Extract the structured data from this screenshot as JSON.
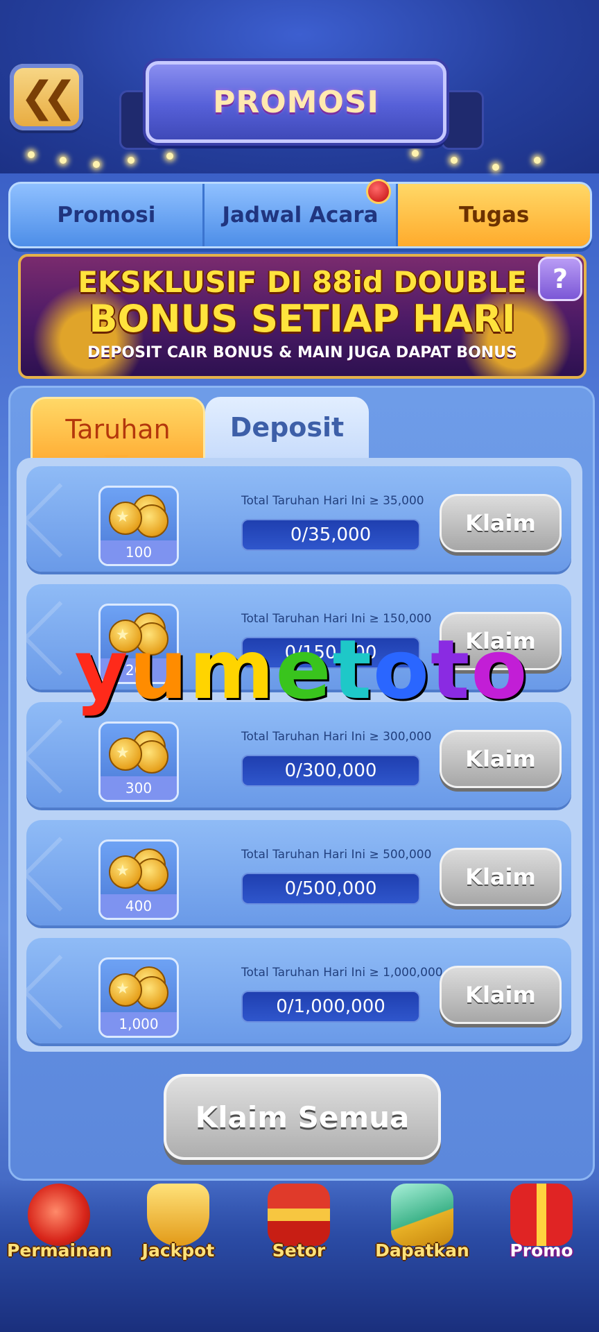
{
  "header": {
    "title": "PROMOSI",
    "back_icon": "double-chevron-left-icon"
  },
  "top_tabs": [
    {
      "label": "Promosi",
      "active": false
    },
    {
      "label": "Jadwal Acara",
      "active": false,
      "has_notification": true
    },
    {
      "label": "Tugas",
      "active": true
    }
  ],
  "banner": {
    "line1": "EKSKLUSIF DI 88id DOUBLE",
    "line2": "BONUS SETIAP HARI",
    "line3": "DEPOSIT CAIR BONUS  & MAIN JUGA DAPAT BONUS",
    "help_label": "?"
  },
  "sub_tabs": [
    {
      "label": "Taruhan",
      "active": true
    },
    {
      "label": "Deposit",
      "active": false
    }
  ],
  "tasks": [
    {
      "reward": "100",
      "label": "Total Taruhan Hari Ini ≥ 35,000",
      "progress": "0/35,000",
      "button": "Klaim"
    },
    {
      "reward": "200",
      "label": "Total Taruhan Hari Ini ≥ 150,000",
      "progress": "0/150,000",
      "button": "Klaim"
    },
    {
      "reward": "300",
      "label": "Total Taruhan Hari Ini ≥ 300,000",
      "progress": "0/300,000",
      "button": "Klaim"
    },
    {
      "reward": "400",
      "label": "Total Taruhan Hari Ini ≥ 500,000",
      "progress": "0/500,000",
      "button": "Klaim"
    },
    {
      "reward": "1,000",
      "label": "Total Taruhan Hari Ini ≥ 1,000,000",
      "progress": "0/1,000,000",
      "button": "Klaim"
    }
  ],
  "claim_all": "Klaim Semua",
  "watermark": "yumetoto",
  "bottom_nav": [
    {
      "label": "Permainan",
      "icon": "slot-machine-icon"
    },
    {
      "label": "Jackpot",
      "icon": "trophy-icon"
    },
    {
      "label": "Setor",
      "icon": "treasure-chest-icon"
    },
    {
      "label": "Dapatkan",
      "icon": "phone-coins-icon"
    },
    {
      "label": "Promo",
      "icon": "gift-box-icon"
    }
  ],
  "colors": {
    "active_tab": "#ffab2c",
    "claim_disabled": "#a7a7a7",
    "progress_bar": "#2f56cc",
    "watermark": [
      "#ff2a1a",
      "#ff8c00",
      "#ffd400",
      "#39c41d",
      "#1ec8c8",
      "#2a66ff",
      "#8a2be2",
      "#c21ed6"
    ]
  }
}
